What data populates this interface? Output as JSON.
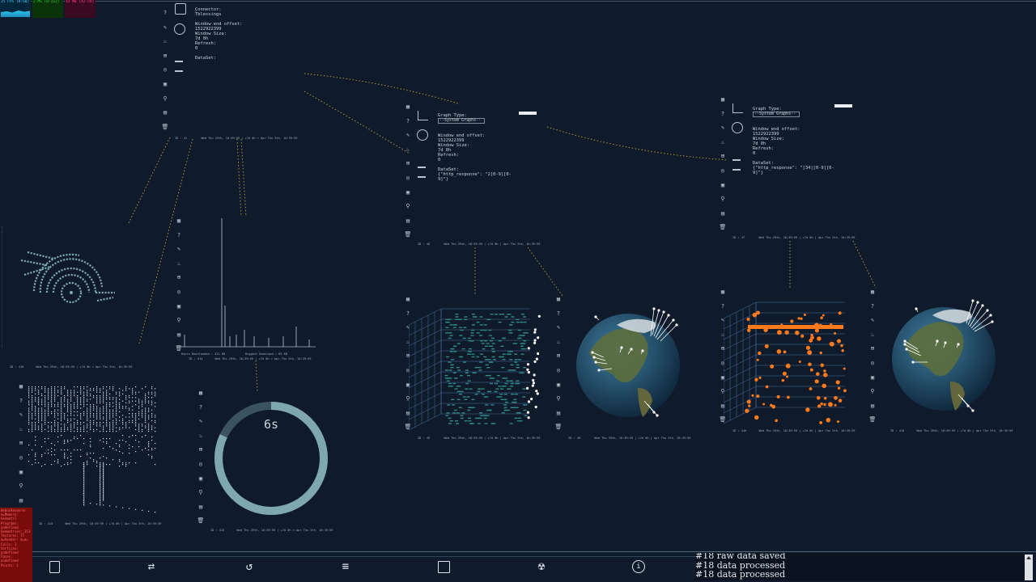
{
  "stats": {
    "fps": "35 FPS (0-60)",
    "ms": "2 MS (0-112)",
    "mb": "43 MB (42-59)"
  },
  "panel_top": {
    "connector_label": "Connector:",
    "connector_value": "Tblessings",
    "window_end_label": "Window end offset:",
    "window_end_value": "1522922399",
    "window_size_label": "Window Size:",
    "window_size_value": "7d 0h",
    "refresh_label": "Refresh:",
    "refresh_value": "0",
    "dataset_label": "DataSet:",
    "footer": "ID : 41        Wed Thu 29th, 10:39:59 | +7d 0h > Apr Thu 5th, 10:39:59"
  },
  "panel_mid": {
    "graph_type_label": "Graph Type:",
    "graph_type_value": "--System Graphs--",
    "window_end_label": "Window end offset:",
    "window_end_value": "1522922399",
    "window_size_label": "Window Size:",
    "window_size_value": "7d 0h",
    "refresh_label": "Refresh:",
    "refresh_value": "0",
    "dataset_label": "DataSet:",
    "dataset_value": "{\"http_response\": \"2[0-9][0-\n9]\"}",
    "footer": "ID : 46        Wed Thu 29th, 10:39:59 | +7d 0h | Apr Thu 5th, 10:39:59"
  },
  "panel_right": {
    "graph_type_label": "Graph Type:",
    "graph_type_value": "--System Graphs--",
    "window_end_label": "Window end offset:",
    "window_end_value": "1522922399",
    "window_size_label": "Window Size:",
    "window_size_value": "7d 0h",
    "refresh_label": "Refresh:",
    "refresh_value": "0",
    "dataset_label": "DataSet:",
    "dataset_value": "{\"http_response\": \"[34][0-9][0-\n9]\"}",
    "footer": "ID : 47        Wed Thu 29th, 10:39:59 | +7d 0h | Apr Thu 5th, 10:39:59"
  },
  "hist_panel": {
    "left_label": "Users Downloaded : 311 KB",
    "right_label": "Biggest Download : 65 KB",
    "footer": "ID : 414       Wed Thu 29th, 10:39:59 | +7d 0h > Apr Thu 5th, 10:39:59"
  },
  "small_footers": {
    "eye": "ID : 410       Wed Thu 29th, 10:39:59 | +7d 0h > Apr Thu 5th, 10:39:59",
    "dots": "ID : 415       Wed Thu 29th, 10:39:59 | +7d 0h | Apr Thu 5th, 10:39:59",
    "ring": "ID : 415       Wed Thu 29th, 10:39:59 | +7d 0h > Apr Thu 5th, 10:39:59",
    "grid_a": "ID : 49        Wed Thu 29th, 10:39:59 | +7d 0h | Apr Thu 5th, 10:39:59",
    "globe_a": "ID : 49        Wed Thu 29th, 10:39:59 | +7d 0h | Apr Thu 5th, 10:39:59",
    "grid_b": "ID : 416       Wed Thu 29th, 10:39:59 | +7d 0h | Apr Thu 5th, 10:39:59",
    "globe_b": "ID : 416       Wed Thu 29th, 10:39:59 | +7d 0h | Apr Thu 5th, 10:39:59"
  },
  "ring": {
    "label": "6s",
    "progress": 0.82
  },
  "console_lines": [
    "#18 raw data saved",
    "#18 data processed",
    "#18 data processed"
  ],
  "debug_lines": [
    "WebGLRenderer",
    "m=Memory: Geometri",
    "Programs: undefined",
    "Geometries: 153",
    "Textures: 77",
    "m=Render: m=m=",
    "Calls: 1",
    "Vertices: undefined",
    "Faces: undefined",
    "Points: 1"
  ],
  "bottom_icons": [
    "report-icon",
    "sync-icon",
    "reload-icon",
    "list-icon",
    "save-icon",
    "radiation-icon",
    "info-icon"
  ],
  "colors": {
    "background": "#0f1a2b",
    "accent": "#7fa8ae",
    "orange": "#ff7a1a",
    "fps": "#39d0ff",
    "ms": "#2bd42b",
    "mb": "#ff3c8e"
  }
}
